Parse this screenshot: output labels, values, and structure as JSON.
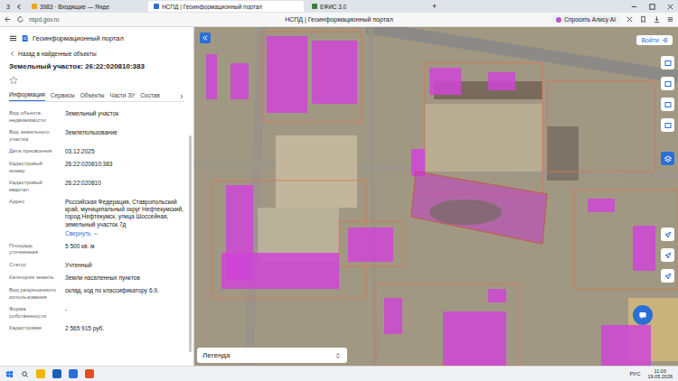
{
  "browser": {
    "window_count": "3",
    "tabs": [
      {
        "label": "3983 · Входящие — Янде",
        "selected": false
      },
      {
        "label": "НСПД | Геоинформационный портал",
        "selected": true
      },
      {
        "label": "ЕФИС 3.0",
        "selected": false
      }
    ],
    "new_tab": "+",
    "url": "nspd.gov.ru",
    "page_title": "НСПД | Геоинформационный портал",
    "alice_button": "Спросить Алису AI"
  },
  "panel": {
    "portal_title": "Геоинформационный портал",
    "back_link": "Назад в найденные объекты",
    "object_title": "Земельный участок: 26:22:020810:383",
    "tabs": [
      {
        "label": "Информация",
        "selected": true
      },
      {
        "label": "Сервисы",
        "selected": false
      },
      {
        "label": "Объекты",
        "selected": false
      },
      {
        "label": "Части ЗУ",
        "selected": false
      },
      {
        "label": "Состав",
        "selected": false
      }
    ],
    "fields": [
      {
        "label": "Вид объекта недвижимости",
        "value": "Земельный участок"
      },
      {
        "label": "Вид земельного участка",
        "value": "Землепользование"
      },
      {
        "label": "Дата присвоения",
        "value": "03.12.2025"
      },
      {
        "label": "Кадастровый номер",
        "value": "26:22:020810:383"
      },
      {
        "label": "Кадастровый квартал",
        "value": "26:22:020810"
      },
      {
        "label": "Адрес",
        "value": "Российская Федерация, Ставропольский край, муниципальный округ Нефтекумский, город Нефтекумск, улица Шоссейная, земельный участок 7д",
        "link": "Свернуть"
      },
      {
        "label": "Площадь уточненная",
        "value": "5 500 кв. м"
      },
      {
        "label": "Статус",
        "value": "Учтенный"
      },
      {
        "label": "Категория земель",
        "value": "Земли населенных пунктов"
      },
      {
        "label": "Вид разрешенного использования",
        "value": "склад, код по классификатору 6.9."
      },
      {
        "label": "Форма собственности",
        "value": "-"
      },
      {
        "label": "Кадастровая",
        "value": "2 565 915 руб."
      }
    ]
  },
  "map": {
    "login_button": "Войти",
    "legend": "Легенда"
  },
  "taskbar": {
    "language": "РУС",
    "time": "11:03",
    "date": "19.05.2026"
  }
}
